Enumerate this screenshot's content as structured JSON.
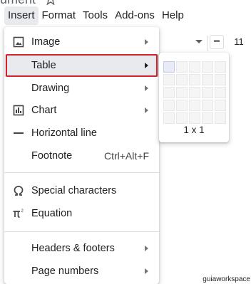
{
  "document": {
    "title_fragment": "ument"
  },
  "menubar": {
    "items": [
      {
        "label": "Insert",
        "active": true
      },
      {
        "label": "Format"
      },
      {
        "label": "Tools"
      },
      {
        "label": "Add-ons"
      },
      {
        "label": "Help"
      }
    ]
  },
  "toolbar": {
    "font_size": "11",
    "minus_label": "−"
  },
  "insert_menu": {
    "items": [
      {
        "id": "image",
        "label": "Image",
        "icon": "image-icon",
        "submenu": true
      },
      {
        "id": "table",
        "label": "Table",
        "icon": "",
        "submenu": true,
        "highlighted": true
      },
      {
        "id": "drawing",
        "label": "Drawing",
        "icon": "",
        "submenu": true
      },
      {
        "id": "chart",
        "label": "Chart",
        "icon": "chart-icon",
        "submenu": true
      },
      {
        "id": "horizontal-line",
        "label": "Horizontal line",
        "icon": "horizontal-line-icon"
      },
      {
        "id": "footnote",
        "label": "Footnote",
        "shortcut": "Ctrl+Alt+F"
      },
      {
        "id": "special-characters",
        "label": "Special characters",
        "icon": "omega-icon"
      },
      {
        "id": "equation",
        "label": "Equation",
        "icon": "pi-icon"
      },
      {
        "id": "headers-footers",
        "label": "Headers & footers",
        "submenu": true
      },
      {
        "id": "page-numbers",
        "label": "Page numbers",
        "submenu": true
      }
    ]
  },
  "table_submenu": {
    "grid_cols": 5,
    "grid_rows": 5,
    "selected_cols": 1,
    "selected_rows": 1,
    "size_label": "1 x 1"
  },
  "watermark": "guiaworkspace"
}
